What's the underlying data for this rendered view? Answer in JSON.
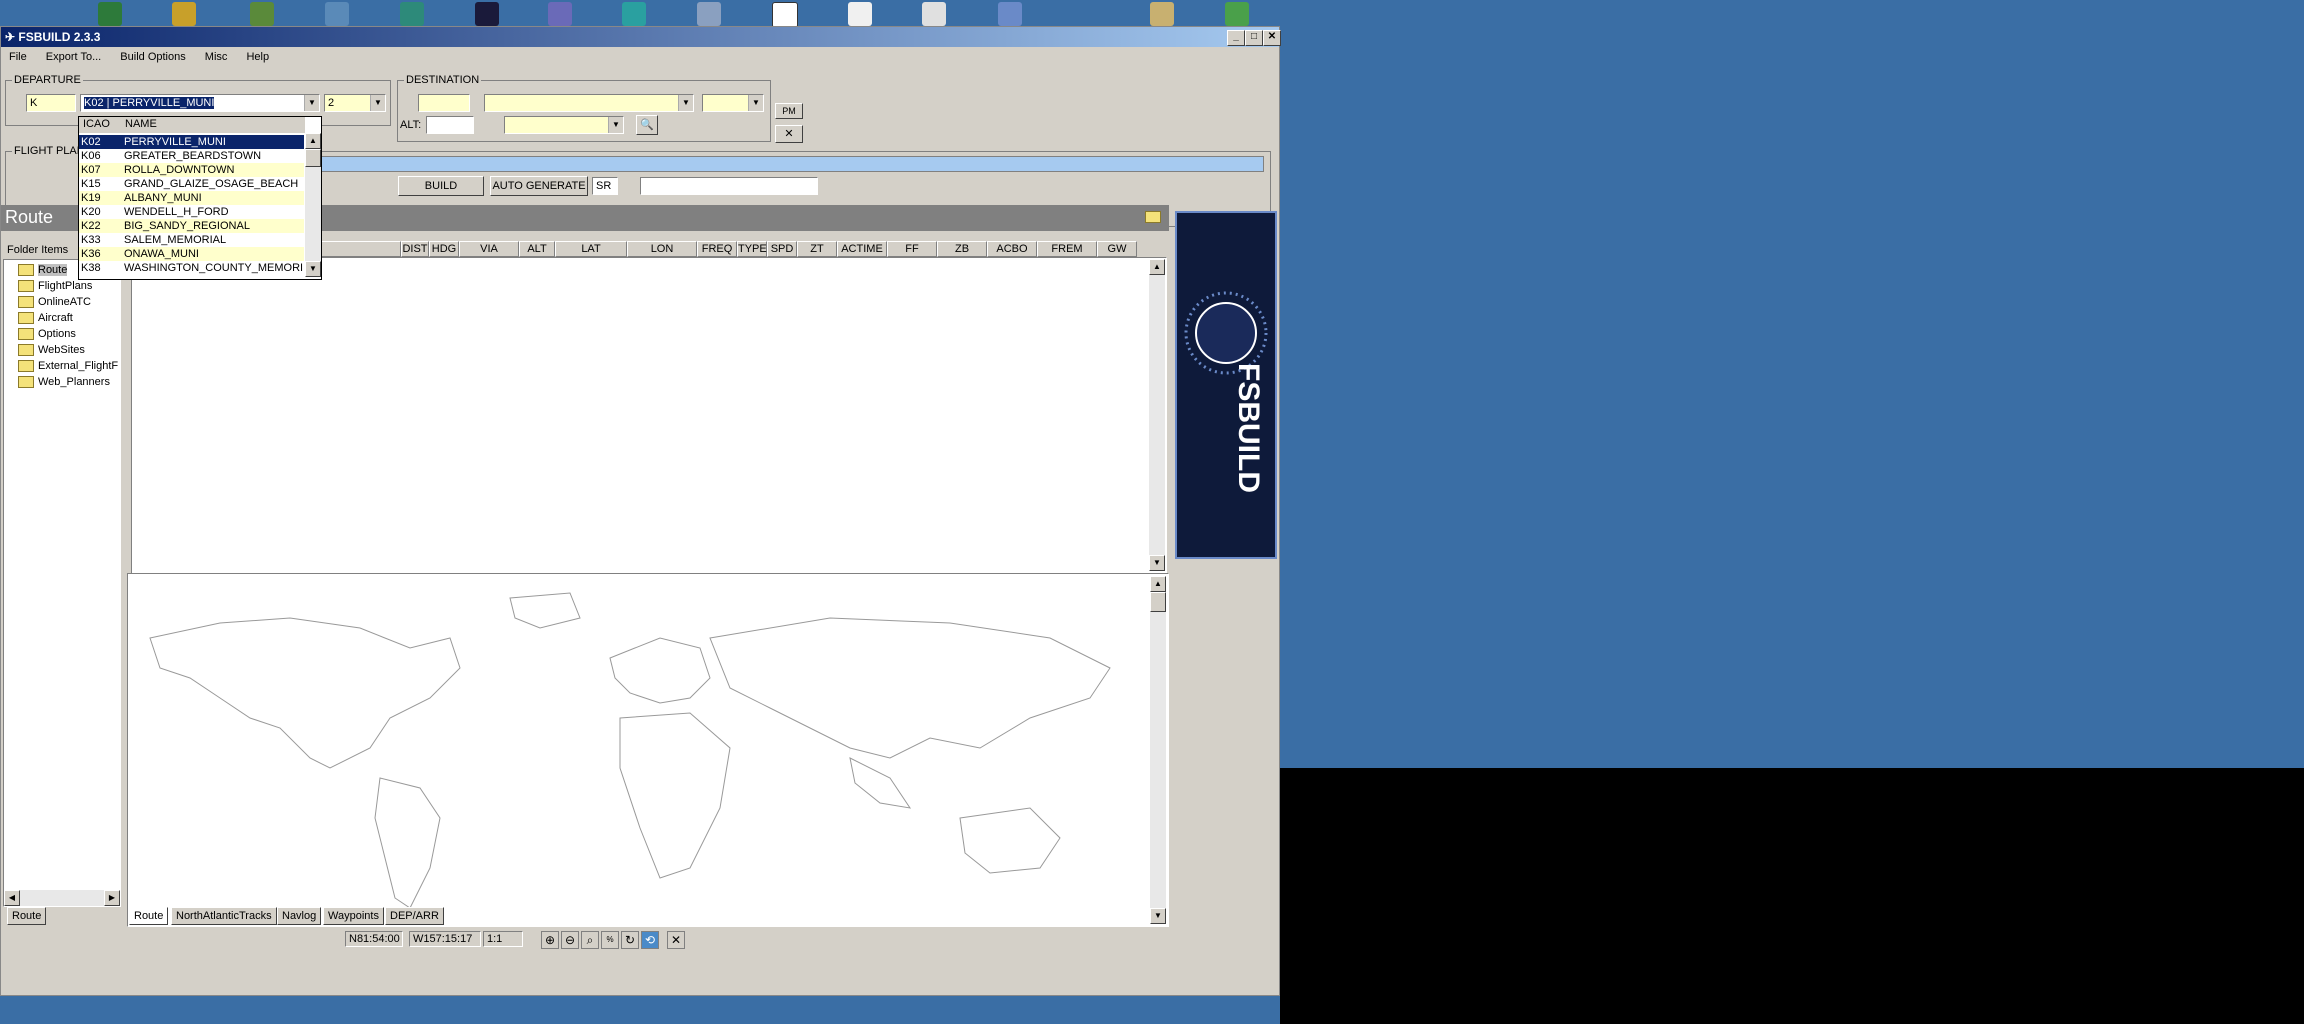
{
  "window": {
    "title": "FSBUILD 2.3.3"
  },
  "menu": [
    "File",
    "Export To...",
    "Build Options",
    "Misc",
    "Help"
  ],
  "departure": {
    "label": "DEPARTURE",
    "prefix": "K",
    "airport": "K02 | PERRYVILLE_MUNI",
    "runway": "2"
  },
  "destination": {
    "label": "DESTINATION",
    "alt_label": "ALT:"
  },
  "buttons": {
    "pm": "PM",
    "build": "BUILD",
    "auto_generate": "AUTO GENERATE",
    "sr": "SR"
  },
  "flightplan": {
    "label": "FLIGHT PLAN"
  },
  "airport_dropdown": {
    "headers": [
      "ICAO",
      "NAME"
    ],
    "rows": [
      {
        "icao": "K02",
        "name": "PERRYVILLE_MUNI",
        "selected": true
      },
      {
        "icao": "K06",
        "name": "GREATER_BEARDSTOWN"
      },
      {
        "icao": "K07",
        "name": "ROLLA_DOWNTOWN"
      },
      {
        "icao": "K15",
        "name": "GRAND_GLAIZE_OSAGE_BEACH"
      },
      {
        "icao": "K19",
        "name": "ALBANY_MUNI"
      },
      {
        "icao": "K20",
        "name": "WENDELL_H_FORD"
      },
      {
        "icao": "K22",
        "name": "BIG_SANDY_REGIONAL"
      },
      {
        "icao": "K33",
        "name": "SALEM_MEMORIAL"
      },
      {
        "icao": "K36",
        "name": "ONAWA_MUNI"
      },
      {
        "icao": "K38",
        "name": "WASHINGTON_COUNTY_MEMORI"
      }
    ]
  },
  "route_panel": {
    "title": "Route"
  },
  "folders": {
    "header": "Folder Items",
    "items": [
      "Route",
      "FlightPlans",
      "OnlineATC",
      "Aircraft",
      "Options",
      "WebSites",
      "External_FlightF",
      "Web_Planners"
    ]
  },
  "route_table": {
    "columns": [
      "DIST",
      "HDG",
      "VIA",
      "ALT",
      "LAT",
      "LON",
      "FREQ",
      "TYPE",
      "SPD",
      "ZT",
      "ACTIME",
      "FF",
      "ZB",
      "ACBO",
      "FREM",
      "GW"
    ]
  },
  "tabs_left": [
    "Route"
  ],
  "tabs_main": [
    "Route",
    "NorthAtlanticTracks",
    "Navlog",
    "Waypoints",
    "DEP/ARR"
  ],
  "status": {
    "lat": "N81:54:00",
    "lon": "W157:15:17",
    "scale": "1:1"
  },
  "logo_text": "FSBUILD",
  "colors": {
    "title_start": "#0a246a",
    "selection": "#0a246a",
    "desktop": "#3a6ea5",
    "input_bg": "#ffffcc"
  }
}
